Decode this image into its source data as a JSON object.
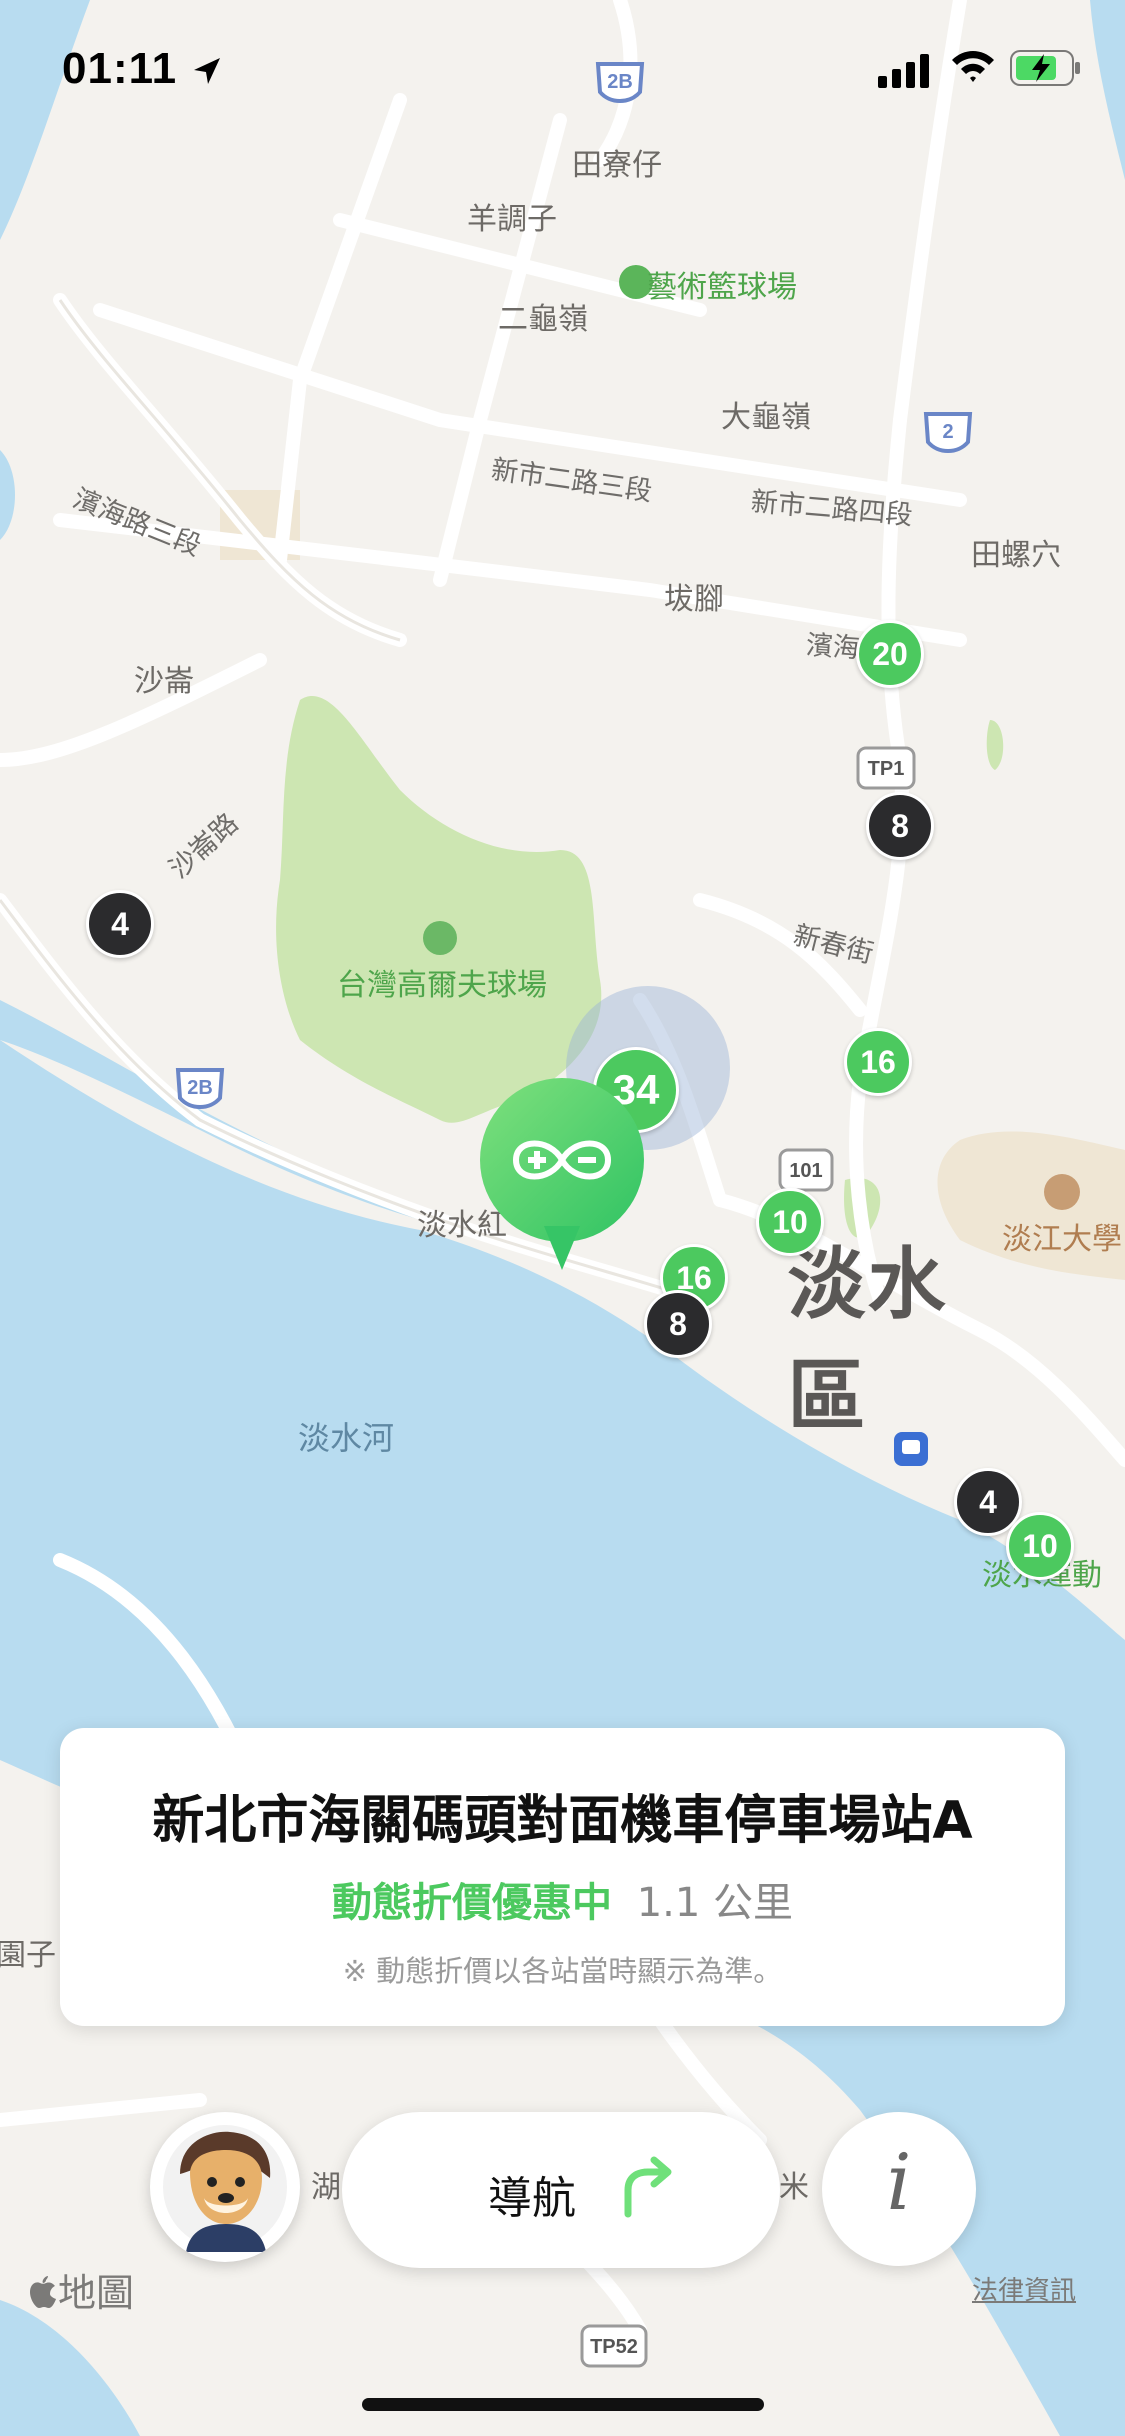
{
  "status_bar": {
    "time": "01:11"
  },
  "map": {
    "places": [
      {
        "key": "tianliaozai",
        "text": "田寮仔"
      },
      {
        "key": "yangdiaozi",
        "text": "羊調子"
      },
      {
        "key": "erguiling",
        "text": "二龜嶺"
      },
      {
        "key": "daguiling",
        "text": "大龜嶺"
      },
      {
        "key": "bajiao",
        "text": "坺腳"
      },
      {
        "key": "shalun",
        "text": "沙崙"
      },
      {
        "key": "tianluoxue",
        "text": "田螺穴"
      },
      {
        "key": "tamsui_red",
        "text": "淡水紅"
      },
      {
        "key": "tamkang",
        "text": "淡江大學"
      },
      {
        "key": "tamsui_sports",
        "text": "淡水運動"
      },
      {
        "key": "yuanzi",
        "text": "園子"
      },
      {
        "key": "hu",
        "text": "湖"
      },
      {
        "key": "mi",
        "text": "米"
      }
    ],
    "roads": [
      {
        "key": "xinshi3",
        "text": "新市二路三段"
      },
      {
        "key": "xinshi4",
        "text": "新市二路四段"
      },
      {
        "key": "binhai3",
        "text": "濱海路三段"
      },
      {
        "key": "binhai1",
        "text": "濱海一段"
      },
      {
        "key": "shalunlu",
        "text": "沙崙路"
      },
      {
        "key": "xinchun",
        "text": "新春街"
      }
    ],
    "parks": [
      {
        "key": "art_court",
        "text": "藝術籃球場"
      },
      {
        "key": "golf",
        "text": "台灣高爾夫球場"
      }
    ],
    "district": "淡水區",
    "river": "淡水河",
    "shields": [
      "2B",
      "2",
      "TP1",
      "2B",
      "101",
      "TP52"
    ],
    "markers": [
      {
        "value": "20",
        "color": "green"
      },
      {
        "value": "8",
        "color": "dark"
      },
      {
        "value": "4",
        "color": "dark"
      },
      {
        "value": "16",
        "color": "green"
      },
      {
        "value": "34",
        "color": "green"
      },
      {
        "value": "10",
        "color": "green"
      },
      {
        "value": "16",
        "color": "green"
      },
      {
        "value": "8",
        "color": "dark"
      },
      {
        "value": "4",
        "color": "dark"
      },
      {
        "value": "10",
        "color": "green"
      }
    ],
    "colors": {
      "water": "#b8dcf0",
      "land": "#f4f2ee",
      "park": "#cde6b2",
      "accent": "#4cc95f"
    }
  },
  "station_card": {
    "title": "新北市海關碼頭對面機車停車場站A",
    "promo": "動態折價優惠中",
    "distance": "1.1 公里",
    "note": "※ 動態折價以各站當時顯示為準。"
  },
  "bottom_bar": {
    "navigate_label": "導航",
    "info_label": "i"
  },
  "footer": {
    "maps_label": "地圖",
    "legal_label": "法律資訊"
  }
}
